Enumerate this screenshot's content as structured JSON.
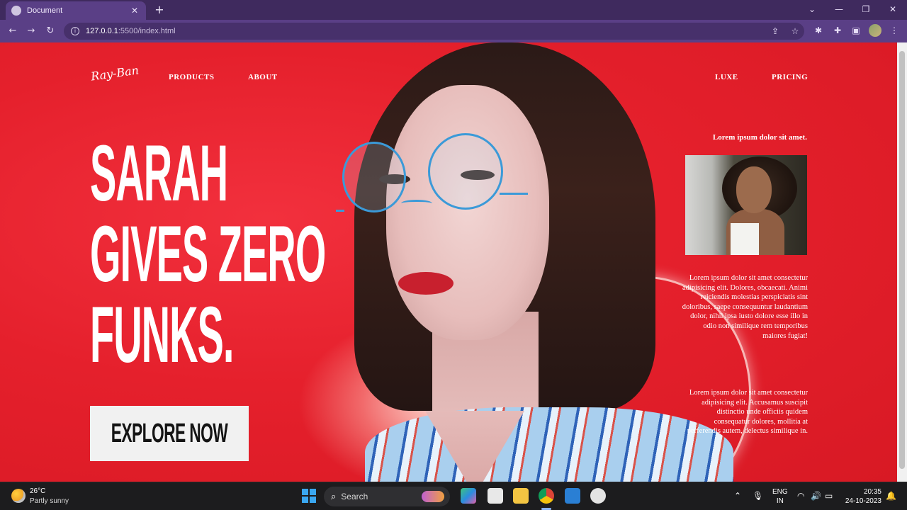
{
  "browser": {
    "tab_title": "Document",
    "tab_close": "✕",
    "new_tab": "+",
    "url_host": "127.0.0.1",
    "url_path": ":5500/index.html",
    "icons": [
      "back-arrow-icon",
      "forward-arrow-icon",
      "reload-icon",
      "info-icon",
      "share-icon",
      "star-icon",
      "extension-icon",
      "puzzle-icon",
      "sidepanel-icon",
      "menu-icon"
    ],
    "window_controls": {
      "dropdown": "⌄",
      "minimize": "—",
      "maximize": "❐",
      "close": "✕"
    }
  },
  "page": {
    "colors": {
      "background": "#e5202c",
      "text": "#ffffff",
      "cta_bg": "#f1f1f1",
      "cta_text": "#141414"
    },
    "nav": {
      "logo": "Ray-Ban",
      "links_left": [
        "PRODUCTS",
        "ABOUT"
      ],
      "links_right": [
        "LUXE",
        "PRICING"
      ]
    },
    "headline": [
      "SARAH",
      "GIVES ZERO",
      "FUNKS."
    ],
    "cta_label": "EXPLORE NOW",
    "sidebar": {
      "caption": "Lorem ipsum dolor sit amet.",
      "paragraph_1": "Lorem ipsum dolor sit amet consectetur adipisicing elit. Dolores, obcaecati. Animi reiciendis molestias perspiciatis sint doloribus, saepe consequuntur laudantium dolor, nihil ipsa iusto dolore esse illo in odio non similique rem temporibus maiores fugiat!",
      "paragraph_2": "Lorem ipsum dolor sit amet consectetur adipisicing elit. Accusamus suscipit distinctio unde officiis quidem consequatur dolores, mollitia at perferendis autem, delectus similique in."
    }
  },
  "taskbar": {
    "weather_temp": "26°C",
    "weather_desc": "Partly sunny",
    "search_label": "Search",
    "language_1": "ENG",
    "language_2": "IN",
    "time": "20:35",
    "date": "24-10-2023"
  }
}
